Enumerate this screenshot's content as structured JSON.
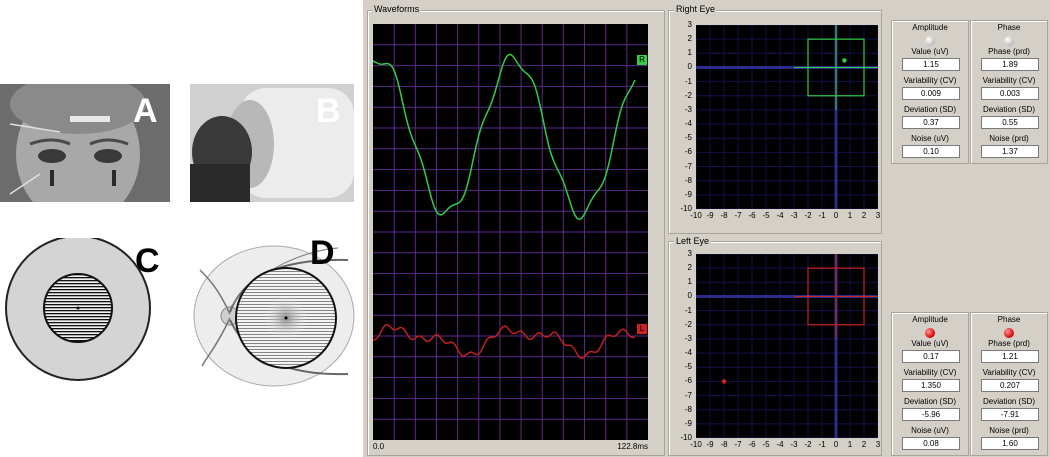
{
  "left_panels": {
    "letters": [
      "A",
      "B",
      "C",
      "D"
    ]
  },
  "waveforms": {
    "title": "Waveforms",
    "marker_right": "R",
    "marker_left": "L",
    "x_start": "0.0",
    "x_end": "122.8ms",
    "colors": {
      "right": "#33cc44",
      "left": "#c02020",
      "grid": "#5a2a8a"
    }
  },
  "right_eye": {
    "title": "Right Eye",
    "y_ticks": [
      "3",
      "2",
      "1",
      "0",
      "-1",
      "-2",
      "-3",
      "-4",
      "-5",
      "-6",
      "-7",
      "-8",
      "-9",
      "-10"
    ],
    "x_ticks": [
      "-10",
      "-9",
      "-8",
      "-7",
      "-6",
      "-5",
      "-4",
      "-3",
      "-2",
      "-1",
      "0",
      "1",
      "2",
      "3"
    ],
    "point": {
      "x": 0.6,
      "y": 0.5
    },
    "color": "#33cc44"
  },
  "left_eye": {
    "title": "Left Eye",
    "y_ticks": [
      "3",
      "2",
      "1",
      "0",
      "-1",
      "-2",
      "-3",
      "-4",
      "-5",
      "-6",
      "-7",
      "-8",
      "-9",
      "-10"
    ],
    "x_ticks": [
      "-10",
      "-9",
      "-8",
      "-7",
      "-6",
      "-5",
      "-4",
      "-3",
      "-2",
      "-1",
      "0",
      "1",
      "2",
      "3"
    ],
    "point": {
      "x": -8.0,
      "y": -6.0
    },
    "color": "#cc2222"
  },
  "metrics_top": {
    "amplitude": {
      "title": "Amplitude",
      "rows": [
        {
          "label": "Value (uV)",
          "value": "1.15"
        },
        {
          "label": "Variability (CV)",
          "value": "0.009"
        },
        {
          "label": "Deviation (SD)",
          "value": "0.37"
        },
        {
          "label": "Noise (uV)",
          "value": "0.10"
        }
      ]
    },
    "phase": {
      "title": "Phase",
      "rows": [
        {
          "label": "Phase (prd)",
          "value": "1.89"
        },
        {
          "label": "Variability (CV)",
          "value": "0.003"
        },
        {
          "label": "Deviation (SD)",
          "value": "0.55"
        },
        {
          "label": "Noise (prd)",
          "value": "1.37"
        }
      ]
    }
  },
  "metrics_bottom": {
    "amplitude": {
      "title": "Amplitude",
      "rows": [
        {
          "label": "Value (uV)",
          "value": "0.17"
        },
        {
          "label": "Variability (CV)",
          "value": "1.350"
        },
        {
          "label": "Deviation (SD)",
          "value": "-5.96"
        },
        {
          "label": "Noise (uV)",
          "value": "0.08"
        }
      ]
    },
    "phase": {
      "title": "Phase",
      "rows": [
        {
          "label": "Phase (prd)",
          "value": "1.21"
        },
        {
          "label": "Variability (CV)",
          "value": "0.207"
        },
        {
          "label": "Deviation (SD)",
          "value": "-7.91"
        },
        {
          "label": "Noise (prd)",
          "value": "1.60"
        }
      ]
    }
  }
}
